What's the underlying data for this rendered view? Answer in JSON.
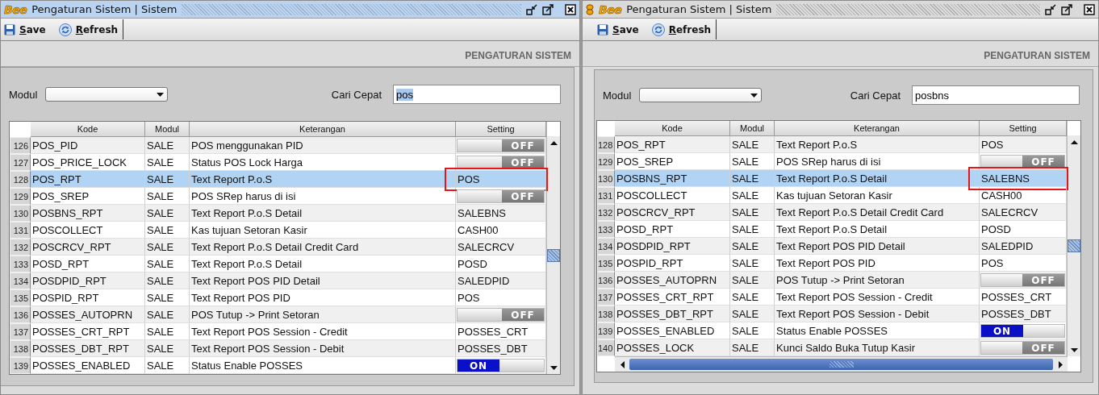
{
  "panes": [
    {
      "active": true,
      "has_bee_icon": false,
      "logo": "Bee",
      "title": "Pengaturan Sistem | Sistem",
      "toolbar": [
        {
          "kind": "save",
          "label": "Save"
        },
        {
          "kind": "refresh",
          "label": "Refresh"
        }
      ],
      "heading": "PENGATURAN SISTEM",
      "modul_label": "Modul",
      "search_label": "Cari Cepat",
      "search_value": "pos",
      "search_text_selected": true,
      "horizontal_scrollbar": false,
      "columns": [
        "Kode",
        "Modul",
        "Keterangan",
        "Setting"
      ],
      "rows": [
        {
          "num": "126",
          "kode": "POS_PID",
          "modul": "SALE",
          "keterangan": "POS menggunakan PID",
          "setting": {
            "kind": "toggle",
            "on": false,
            "label": "OFF"
          },
          "selected": false,
          "highlighted": false
        },
        {
          "num": "127",
          "kode": "POS_PRICE_LOCK",
          "modul": "SALE",
          "keterangan": "Status POS Lock Harga",
          "setting": {
            "kind": "toggle",
            "on": false,
            "label": "OFF"
          },
          "selected": false,
          "highlighted": false
        },
        {
          "num": "128",
          "kode": "POS_RPT",
          "modul": "SALE",
          "keterangan": "Text Report P.o.S",
          "setting": {
            "kind": "text",
            "value": "POS"
          },
          "selected": true,
          "highlighted": true
        },
        {
          "num": "129",
          "kode": "POS_SREP",
          "modul": "SALE",
          "keterangan": "POS SRep harus di isi",
          "setting": {
            "kind": "toggle",
            "on": false,
            "label": "OFF"
          },
          "selected": false,
          "highlighted": false
        },
        {
          "num": "130",
          "kode": "POSBNS_RPT",
          "modul": "SALE",
          "keterangan": "Text Report P.o.S Detail",
          "setting": {
            "kind": "text",
            "value": "SALEBNS"
          },
          "selected": false,
          "highlighted": false
        },
        {
          "num": "131",
          "kode": "POSCOLLECT",
          "modul": "SALE",
          "keterangan": "Kas tujuan Setoran Kasir",
          "setting": {
            "kind": "text",
            "value": "CASH00"
          },
          "selected": false,
          "highlighted": false
        },
        {
          "num": "132",
          "kode": "POSCRCV_RPT",
          "modul": "SALE",
          "keterangan": "Text Report P.o.S Detail Credit Card",
          "setting": {
            "kind": "text",
            "value": "SALECRCV"
          },
          "selected": false,
          "highlighted": false
        },
        {
          "num": "133",
          "kode": "POSD_RPT",
          "modul": "SALE",
          "keterangan": "Text Report P.o.S Detail",
          "setting": {
            "kind": "text",
            "value": "POSD"
          },
          "selected": false,
          "highlighted": false
        },
        {
          "num": "134",
          "kode": "POSDPID_RPT",
          "modul": "SALE",
          "keterangan": "Text Report POS PID Detail",
          "setting": {
            "kind": "text",
            "value": "SALEDPID"
          },
          "selected": false,
          "highlighted": false
        },
        {
          "num": "135",
          "kode": "POSPID_RPT",
          "modul": "SALE",
          "keterangan": "Text Report POS PID",
          "setting": {
            "kind": "text",
            "value": "POS"
          },
          "selected": false,
          "highlighted": false
        },
        {
          "num": "136",
          "kode": "POSSES_AUTOPRN",
          "modul": "SALE",
          "keterangan": "POS Tutup -> Print Setoran",
          "setting": {
            "kind": "toggle",
            "on": false,
            "label": "OFF"
          },
          "selected": false,
          "highlighted": false
        },
        {
          "num": "137",
          "kode": "POSSES_CRT_RPT",
          "modul": "SALE",
          "keterangan": "Text Report POS Session - Credit",
          "setting": {
            "kind": "text",
            "value": "POSSES_CRT"
          },
          "selected": false,
          "highlighted": false
        },
        {
          "num": "138",
          "kode": "POSSES_DBT_RPT",
          "modul": "SALE",
          "keterangan": "Text Report POS Session - Debit",
          "setting": {
            "kind": "text",
            "value": "POSSES_DBT"
          },
          "selected": false,
          "highlighted": false
        },
        {
          "num": "139",
          "kode": "POSSES_ENABLED",
          "modul": "SALE",
          "keterangan": "Status Enable POSSES",
          "setting": {
            "kind": "toggle",
            "on": true,
            "label": "ON"
          },
          "selected": false,
          "highlighted": false
        }
      ]
    },
    {
      "active": false,
      "has_bee_icon": true,
      "logo": "Bee",
      "title": "Pengaturan Sistem | Sistem",
      "toolbar": [
        {
          "kind": "save",
          "label": "Save"
        },
        {
          "kind": "refresh",
          "label": "Refresh"
        }
      ],
      "heading": "PENGATURAN SISTEM",
      "modul_label": "Modul",
      "search_label": "Cari Cepat",
      "search_value": "posbns",
      "search_text_selected": false,
      "horizontal_scrollbar": true,
      "columns": [
        "Kode",
        "Modul",
        "Keterangan",
        "Setting"
      ],
      "rows": [
        {
          "num": "128",
          "kode": "POS_RPT",
          "modul": "SALE",
          "keterangan": "Text Report P.o.S",
          "setting": {
            "kind": "text",
            "value": "POS"
          },
          "selected": false,
          "highlighted": false
        },
        {
          "num": "129",
          "kode": "POS_SREP",
          "modul": "SALE",
          "keterangan": "POS SRep harus di isi",
          "setting": {
            "kind": "toggle",
            "on": false,
            "label": "OFF"
          },
          "selected": false,
          "highlighted": false
        },
        {
          "num": "130",
          "kode": "POSBNS_RPT",
          "modul": "SALE",
          "keterangan": "Text Report P.o.S Detail",
          "setting": {
            "kind": "text",
            "value": "SALEBNS"
          },
          "selected": true,
          "highlighted": true
        },
        {
          "num": "131",
          "kode": "POSCOLLECT",
          "modul": "SALE",
          "keterangan": "Kas tujuan Setoran Kasir",
          "setting": {
            "kind": "text",
            "value": "CASH00"
          },
          "selected": false,
          "highlighted": false
        },
        {
          "num": "132",
          "kode": "POSCRCV_RPT",
          "modul": "SALE",
          "keterangan": "Text Report P.o.S Detail Credit Card",
          "setting": {
            "kind": "text",
            "value": "SALECRCV"
          },
          "selected": false,
          "highlighted": false
        },
        {
          "num": "133",
          "kode": "POSD_RPT",
          "modul": "SALE",
          "keterangan": "Text Report P.o.S Detail",
          "setting": {
            "kind": "text",
            "value": "POSD"
          },
          "selected": false,
          "highlighted": false
        },
        {
          "num": "134",
          "kode": "POSDPID_RPT",
          "modul": "SALE",
          "keterangan": "Text Report POS PID Detail",
          "setting": {
            "kind": "text",
            "value": "SALEDPID"
          },
          "selected": false,
          "highlighted": false
        },
        {
          "num": "135",
          "kode": "POSPID_RPT",
          "modul": "SALE",
          "keterangan": "Text Report POS PID",
          "setting": {
            "kind": "text",
            "value": "POS"
          },
          "selected": false,
          "highlighted": false
        },
        {
          "num": "136",
          "kode": "POSSES_AUTOPRN",
          "modul": "SALE",
          "keterangan": "POS Tutup -> Print Setoran",
          "setting": {
            "kind": "toggle",
            "on": false,
            "label": "OFF"
          },
          "selected": false,
          "highlighted": false
        },
        {
          "num": "137",
          "kode": "POSSES_CRT_RPT",
          "modul": "SALE",
          "keterangan": "Text Report POS Session - Credit",
          "setting": {
            "kind": "text",
            "value": "POSSES_CRT"
          },
          "selected": false,
          "highlighted": false
        },
        {
          "num": "138",
          "kode": "POSSES_DBT_RPT",
          "modul": "SALE",
          "keterangan": "Text Report POS Session - Debit",
          "setting": {
            "kind": "text",
            "value": "POSSES_DBT"
          },
          "selected": false,
          "highlighted": false
        },
        {
          "num": "139",
          "kode": "POSSES_ENABLED",
          "modul": "SALE",
          "keterangan": "Status Enable POSSES",
          "setting": {
            "kind": "toggle",
            "on": true,
            "label": "ON"
          },
          "selected": false,
          "highlighted": false
        },
        {
          "num": "140",
          "kode": "POSSES_LOCK",
          "modul": "SALE",
          "keterangan": "Kunci Saldo Buka Tutup Kasir",
          "setting": {
            "kind": "toggle",
            "on": false,
            "label": "OFF"
          },
          "selected": false,
          "highlighted": false
        }
      ]
    }
  ]
}
